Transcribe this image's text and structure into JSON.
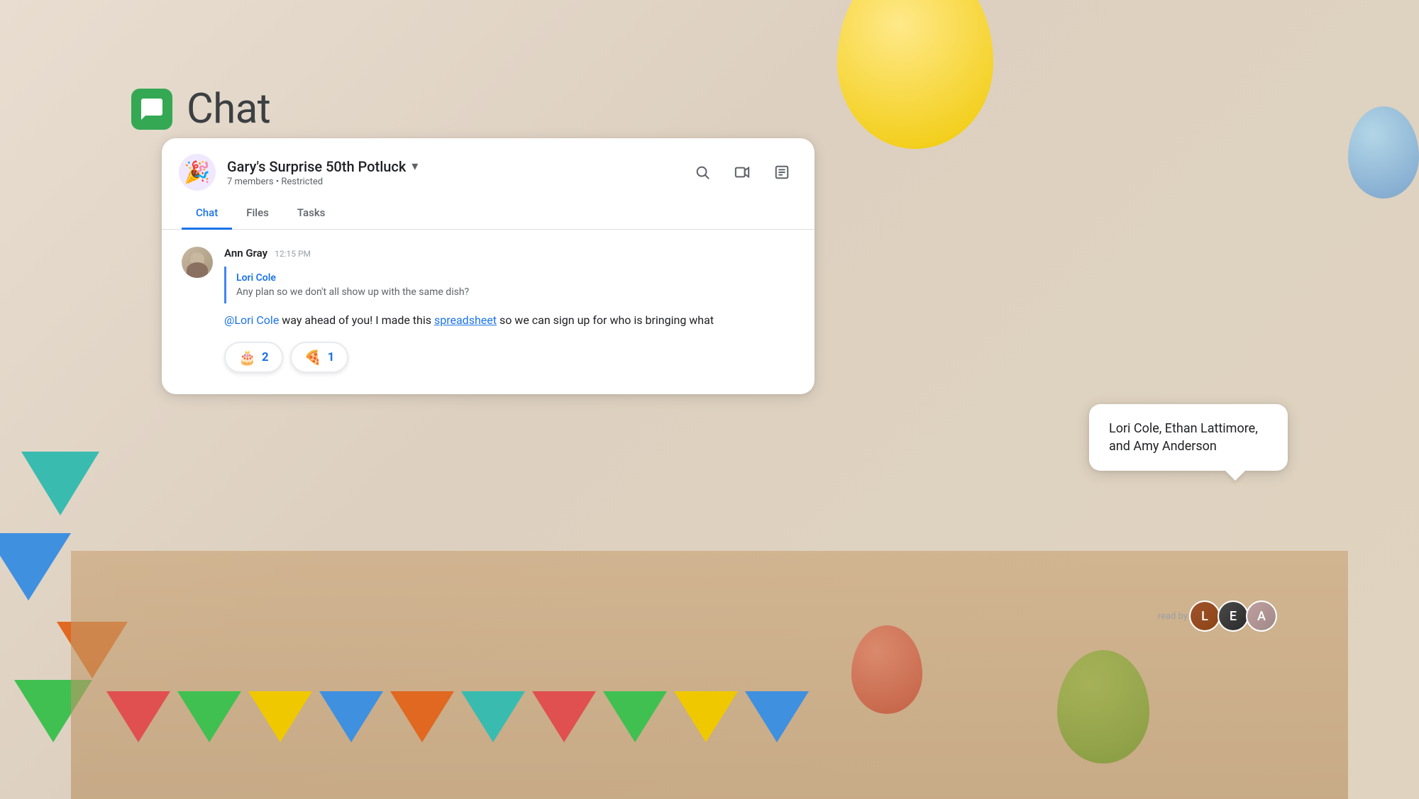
{
  "background": {
    "color": "#e8ddd0"
  },
  "app": {
    "title": "Chat",
    "logo_color": "#34a853"
  },
  "chat_card": {
    "group_name": "Gary's Surprise 50th Potluck",
    "group_emoji": "🎉",
    "members_meta": "7 members • Restricted",
    "chevron": "▾",
    "tabs": [
      {
        "label": "Chat",
        "active": true
      },
      {
        "label": "Files",
        "active": false
      },
      {
        "label": "Tasks",
        "active": false
      }
    ],
    "message": {
      "sender": "Ann Gray",
      "time": "12:15 PM",
      "quoted_sender": "Lori Cole",
      "quoted_text": "Any plan so we don't all show up with the same dish?",
      "mention": "@Lori Cole",
      "text_before_link": " way ahead of you! I made this ",
      "link_text": "spreadsheet",
      "text_after_link": " so we can sign up for who is bringing what"
    },
    "reactions": [
      {
        "emoji": "🎂",
        "count": "2"
      },
      {
        "emoji": "🍕",
        "count": "1"
      }
    ],
    "read_by": {
      "label": "read by",
      "names": "Lori Cole, Ethan Lattimore, and Amy Anderson",
      "avatars": [
        {
          "initials": "L",
          "color1": "#a0522d",
          "color2": "#8b4513"
        },
        {
          "initials": "E",
          "color1": "#4a4a4a",
          "color2": "#2a2a2a"
        },
        {
          "initials": "A",
          "color1": "#c0a0a0",
          "color2": "#a08888"
        }
      ]
    }
  },
  "icons": {
    "search": "🔍",
    "video": "▣",
    "notes": "≡"
  }
}
